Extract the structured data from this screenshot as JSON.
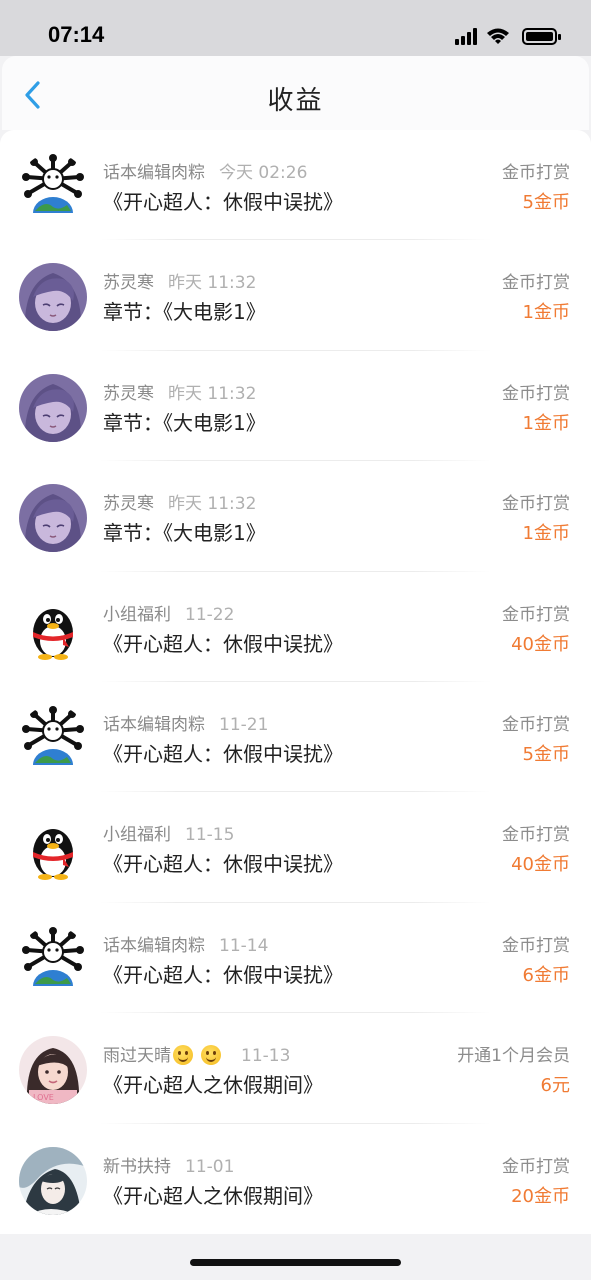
{
  "status_bar": {
    "time": "07:14"
  },
  "nav": {
    "title": "收益"
  },
  "rows": [
    {
      "avatar": "antenna-globe-avatar",
      "name": "话本编辑肉粽",
      "time": "今天 02:26",
      "title": "《开心超人：休假中误扰》",
      "type": "金币打赏",
      "amount": "5金币"
    },
    {
      "avatar": "anime-girl-avatar",
      "name": "苏灵寒",
      "time": "昨天 11:32",
      "title": "章节：《大电影1》",
      "type": "金币打赏",
      "amount": "1金币"
    },
    {
      "avatar": "anime-girl-avatar",
      "name": "苏灵寒",
      "time": "昨天 11:32",
      "title": "章节：《大电影1》",
      "type": "金币打赏",
      "amount": "1金币"
    },
    {
      "avatar": "anime-girl-avatar",
      "name": "苏灵寒",
      "time": "昨天 11:32",
      "title": "章节：《大电影1》",
      "type": "金币打赏",
      "amount": "1金币"
    },
    {
      "avatar": "penguin-avatar",
      "name": "小组福利",
      "time": "11-22",
      "title": "《开心超人：休假中误扰》",
      "type": "金币打赏",
      "amount": "40金币"
    },
    {
      "avatar": "antenna-globe-avatar",
      "name": "话本编辑肉粽",
      "time": "11-21",
      "title": "《开心超人：休假中误扰》",
      "type": "金币打赏",
      "amount": "5金币"
    },
    {
      "avatar": "penguin-avatar",
      "name": "小组福利",
      "time": "11-15",
      "title": "《开心超人：休假中误扰》",
      "type": "金币打赏",
      "amount": "40金币"
    },
    {
      "avatar": "antenna-globe-avatar",
      "name": "话本编辑肉粽",
      "time": "11-14",
      "title": "《开心超人：休假中误扰》",
      "type": "金币打赏",
      "amount": "6金币"
    },
    {
      "avatar": "girl-photo-avatar",
      "name": "雨过天晴",
      "emoji": "smile-emoji",
      "time": "11-13",
      "title": "《开心超人之休假期间》",
      "type": "开通1个月会员",
      "amount": "6元"
    },
    {
      "avatar": "ink-portrait-avatar",
      "name": "新书扶持",
      "time": "11-01",
      "title": "《开心超人之休假期间》",
      "type": "金币打赏",
      "amount": "20金币"
    }
  ],
  "colors": {
    "amount": "#f07b34",
    "back_arrow": "#2f9ee6",
    "meta_text": "#9c9c9c"
  }
}
